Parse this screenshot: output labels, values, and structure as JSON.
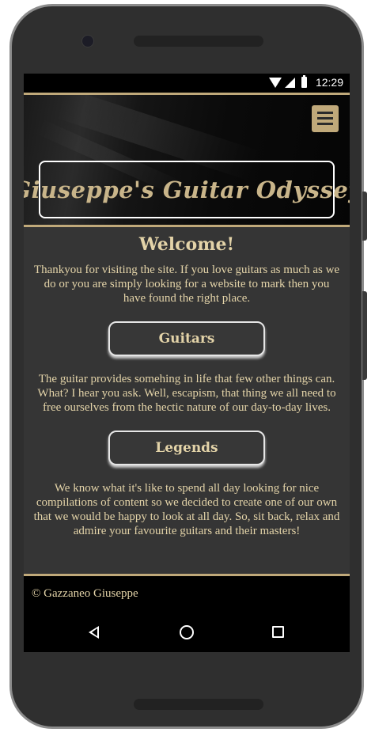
{
  "status_bar": {
    "time": "12:29"
  },
  "header": {
    "site_title": "Giuseppe's Guitar Odyssey"
  },
  "main": {
    "welcome_heading": "Welcome!",
    "intro": "Thankyou for visiting the site. If you love guitars as much as we do or you are simply looking for a website to mark then you have found the right place.",
    "guitars_button": "Guitars",
    "guitars_text": "The guitar provides somehing in life that few other things can. What? I hear you ask. Well, escapism, that thing we all need to free ourselves from the hectic nature of our day-to-day lives.",
    "legends_button": "Legends",
    "legends_text": "We know what it's like to spend all day looking for nice compilations of content so we decided to create one of our own that we would be happy to look at all day. So, sit back, relax and admire your favourite guitars and their masters!"
  },
  "footer": {
    "copyright": "© Gazzaneo Giuseppe"
  },
  "colors": {
    "accent": "#c0a97a",
    "text": "#e3d3a8",
    "background": "#353535"
  }
}
